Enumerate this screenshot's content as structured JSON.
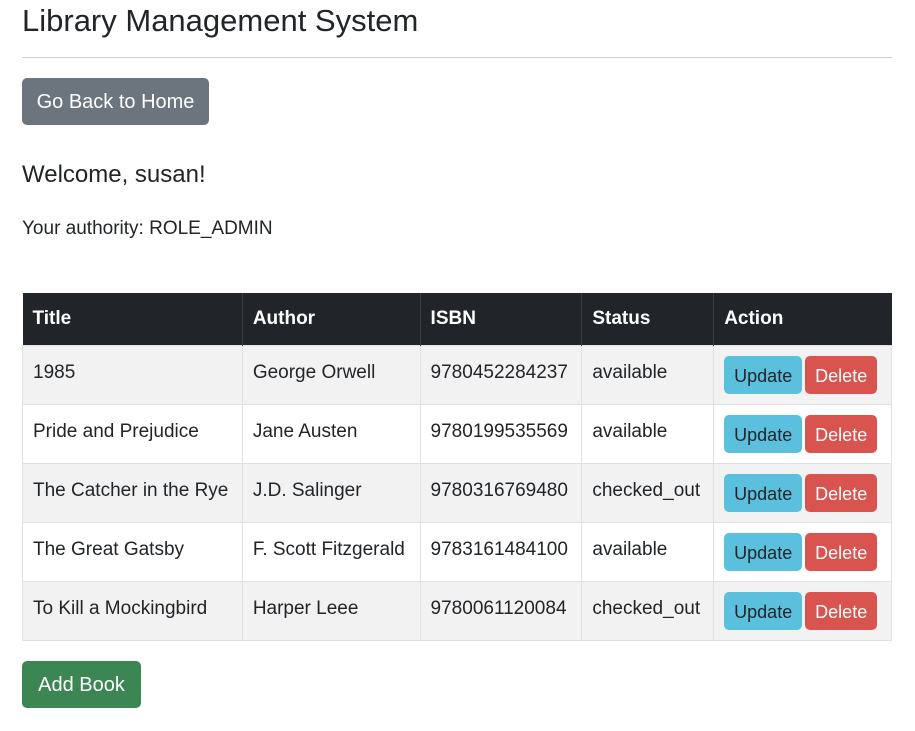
{
  "header": {
    "title": "Library Management System"
  },
  "nav": {
    "home_button_label": "Go Back to Home"
  },
  "user": {
    "welcome_text": "Welcome, susan!",
    "authority_text": "Your authority: ROLE_ADMIN"
  },
  "table": {
    "columns": [
      "Title",
      "Author",
      "ISBN",
      "Status",
      "Action"
    ],
    "rows": [
      {
        "title": "1985",
        "author": "George Orwell",
        "isbn": "9780452284237",
        "status": "available"
      },
      {
        "title": "Pride and Prejudice",
        "author": "Jane Austen",
        "isbn": "9780199535569",
        "status": "available"
      },
      {
        "title": "The Catcher in the Rye",
        "author": "J.D. Salinger",
        "isbn": "9780316769480",
        "status": "checked_out"
      },
      {
        "title": "The Great Gatsby",
        "author": "F. Scott Fitzgerald",
        "isbn": "9783161484100",
        "status": "available"
      },
      {
        "title": "To Kill a Mockingbird",
        "author": "Harper Leee",
        "isbn": "9780061120084",
        "status": "checked_out"
      }
    ],
    "update_label": "Update",
    "delete_label": "Delete"
  },
  "footer": {
    "add_button_label": "Add Book"
  },
  "colors": {
    "header_bg": "#212529",
    "home_button": "#6c757d",
    "update_button": "#5bc0de",
    "delete_button": "#d9534f",
    "add_button": "#3b8653"
  }
}
